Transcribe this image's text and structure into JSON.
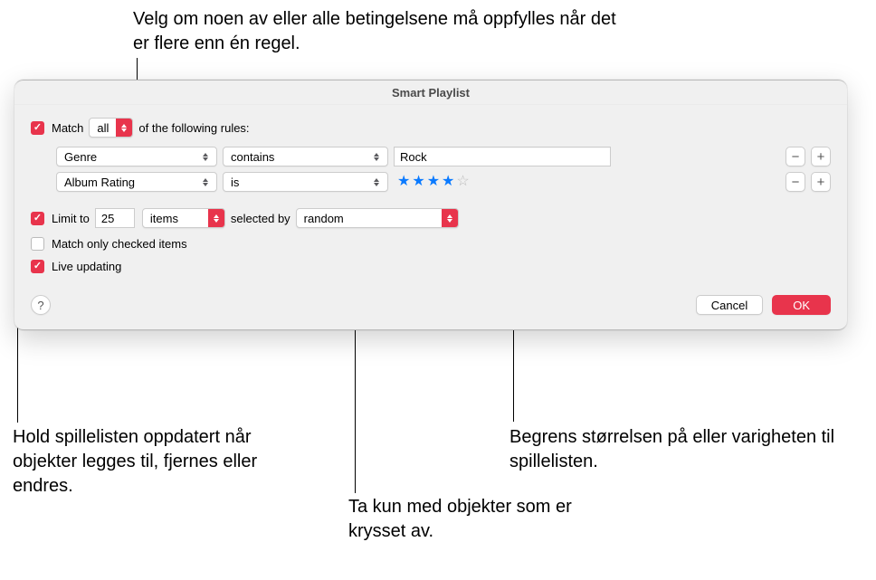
{
  "callouts": {
    "top": "Velg om noen av eller alle betingelsene må oppfylles når det er flere enn én regel.",
    "live_updating": "Hold spillelisten oppdatert når objekter legges til, fjernes eller endres.",
    "match_checked": "Ta kun med objekter som er krysset av.",
    "limit": "Begrens størrelsen på eller varigheten til spillelisten."
  },
  "dialog": {
    "title": "Smart Playlist",
    "match_row": {
      "prefix": "Match",
      "mode": "all",
      "suffix": "of the following rules:"
    },
    "rules": [
      {
        "attribute": "Genre",
        "operator": "contains",
        "value": "Rock",
        "type": "text"
      },
      {
        "attribute": "Album Rating",
        "operator": "is",
        "stars_filled": 4,
        "stars_total": 5,
        "type": "rating"
      }
    ],
    "limit": {
      "prefix": "Limit to",
      "count": "25",
      "unit": "items",
      "selected_by_label": "selected by",
      "selected_by_value": "random"
    },
    "match_checked_label": "Match only checked items",
    "live_updating_label": "Live updating",
    "buttons": {
      "cancel": "Cancel",
      "ok": "OK",
      "help": "?"
    }
  }
}
